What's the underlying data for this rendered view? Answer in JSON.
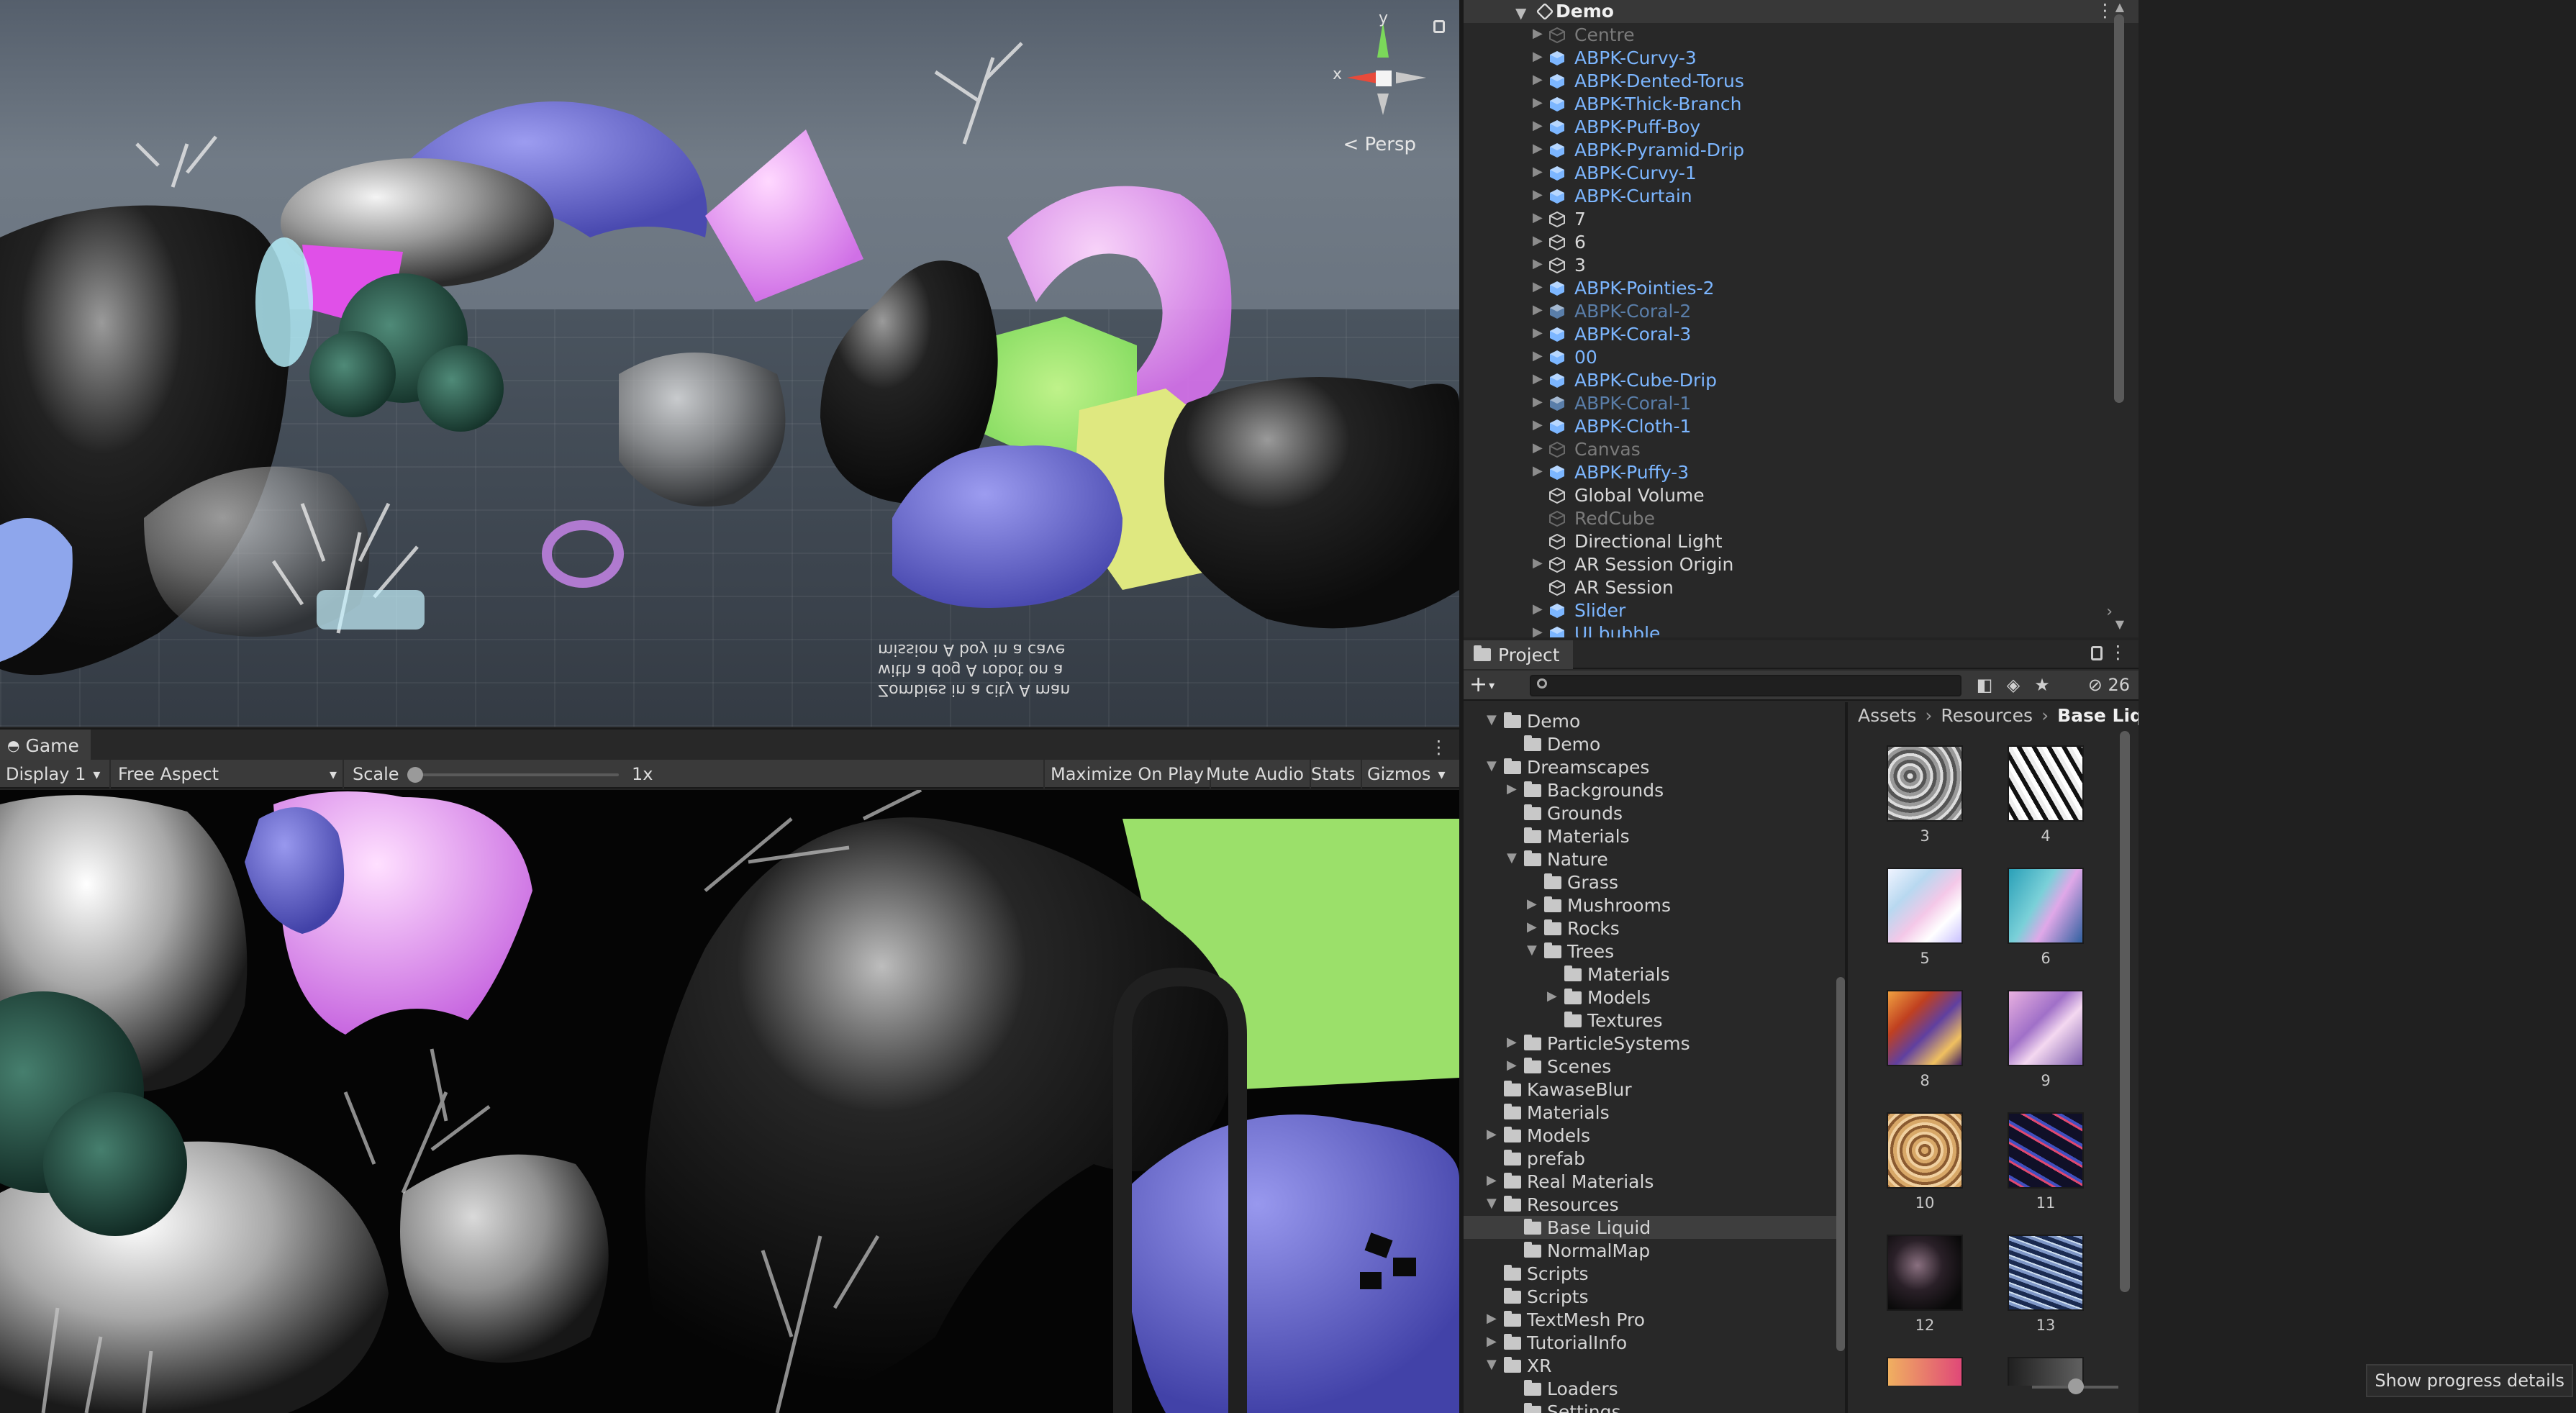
{
  "scene": {
    "persp_label": "Persp",
    "gizmo_axes": {
      "y": "y",
      "x": "x"
    },
    "overlay_text": "Zombies in a city A man with a dog A robot on a mission A boy in a cave"
  },
  "game": {
    "tab_label": "Game",
    "toolbar": {
      "display": "Display 1",
      "aspect": "Free Aspect",
      "scale_label": "Scale",
      "scale_value": "1x",
      "maximize": "Maximize On Play",
      "mute": "Mute Audio",
      "stats": "Stats",
      "gizmos": "Gizmos"
    }
  },
  "hierarchy": {
    "scene_name": "Demo",
    "items": [
      {
        "name": "Centre",
        "kind": "inactive",
        "expandable": true
      },
      {
        "name": "ABPK-Curvy-3",
        "kind": "prefab",
        "expandable": true
      },
      {
        "name": "ABPK-Dented-Torus",
        "kind": "prefab",
        "expandable": true
      },
      {
        "name": "ABPK-Thick-Branch",
        "kind": "prefab",
        "expandable": true
      },
      {
        "name": "ABPK-Puff-Boy",
        "kind": "prefab",
        "expandable": true
      },
      {
        "name": "ABPK-Pyramid-Drip",
        "kind": "prefab",
        "expandable": true
      },
      {
        "name": "ABPK-Curvy-1",
        "kind": "prefab",
        "expandable": true
      },
      {
        "name": "ABPK-Curtain",
        "kind": "prefab",
        "expandable": true
      },
      {
        "name": "7",
        "kind": "object",
        "expandable": true
      },
      {
        "name": "6",
        "kind": "object",
        "expandable": true
      },
      {
        "name": "3",
        "kind": "object",
        "expandable": true
      },
      {
        "name": "ABPK-Pointies-2",
        "kind": "prefab",
        "expandable": true
      },
      {
        "name": "ABPK-Coral-2",
        "kind": "prefab-inactive",
        "expandable": true
      },
      {
        "name": "ABPK-Coral-3",
        "kind": "prefab",
        "expandable": true
      },
      {
        "name": "00",
        "kind": "prefab",
        "expandable": true
      },
      {
        "name": "ABPK-Cube-Drip",
        "kind": "prefab",
        "expandable": true
      },
      {
        "name": "ABPK-Coral-1",
        "kind": "prefab-inactive",
        "expandable": true
      },
      {
        "name": "ABPK-Cloth-1",
        "kind": "prefab",
        "expandable": true
      },
      {
        "name": "Canvas",
        "kind": "inactive",
        "expandable": true
      },
      {
        "name": "ABPK-Puffy-3",
        "kind": "prefab",
        "expandable": true
      },
      {
        "name": "Global Volume",
        "kind": "object",
        "expandable": false
      },
      {
        "name": "RedCube",
        "kind": "inactive",
        "expandable": false
      },
      {
        "name": "Directional Light",
        "kind": "object",
        "expandable": false
      },
      {
        "name": "AR Session Origin",
        "kind": "object",
        "expandable": true
      },
      {
        "name": "AR Session",
        "kind": "object",
        "expandable": false
      },
      {
        "name": "Slider",
        "kind": "prefab",
        "expandable": true
      },
      {
        "name": "UI bubble",
        "kind": "prefab",
        "expandable": true
      }
    ]
  },
  "project": {
    "tab_label": "Project",
    "search": {
      "value": "",
      "placeholder": ""
    },
    "hidden_count": "26",
    "breadcrumb": [
      "Assets",
      "Resources",
      "Base Liquid"
    ],
    "tree": [
      {
        "label": "Demo",
        "depth": 0,
        "state": "open"
      },
      {
        "label": "Demo",
        "depth": 1,
        "state": "leaf"
      },
      {
        "label": "Dreamscapes",
        "depth": 0,
        "state": "open"
      },
      {
        "label": "Backgrounds",
        "depth": 1,
        "state": "closed"
      },
      {
        "label": "Grounds",
        "depth": 1,
        "state": "leaf"
      },
      {
        "label": "Materials",
        "depth": 1,
        "state": "leaf"
      },
      {
        "label": "Nature",
        "depth": 1,
        "state": "open"
      },
      {
        "label": "Grass",
        "depth": 2,
        "state": "leaf"
      },
      {
        "label": "Mushrooms",
        "depth": 2,
        "state": "closed"
      },
      {
        "label": "Rocks",
        "depth": 2,
        "state": "closed"
      },
      {
        "label": "Trees",
        "depth": 2,
        "state": "open"
      },
      {
        "label": "Materials",
        "depth": 3,
        "state": "leaf"
      },
      {
        "label": "Models",
        "depth": 3,
        "state": "closed"
      },
      {
        "label": "Textures",
        "depth": 3,
        "state": "leaf"
      },
      {
        "label": "ParticleSystems",
        "depth": 1,
        "state": "closed"
      },
      {
        "label": "Scenes",
        "depth": 1,
        "state": "closed"
      },
      {
        "label": "KawaseBlur",
        "depth": 0,
        "state": "leaf"
      },
      {
        "label": "Materials",
        "depth": 0,
        "state": "leaf"
      },
      {
        "label": "Models",
        "depth": 0,
        "state": "closed"
      },
      {
        "label": "prefab",
        "depth": 0,
        "state": "leaf"
      },
      {
        "label": "Real Materials",
        "depth": 0,
        "state": "closed"
      },
      {
        "label": "Resources",
        "depth": 0,
        "state": "open"
      },
      {
        "label": "Base Liquid",
        "depth": 1,
        "state": "leaf",
        "selected": true
      },
      {
        "label": "NormalMap",
        "depth": 1,
        "state": "leaf"
      },
      {
        "label": "Scripts",
        "depth": 0,
        "state": "leaf"
      },
      {
        "label": "Scripts",
        "depth": 0,
        "state": "leaf"
      },
      {
        "label": "TextMesh Pro",
        "depth": 0,
        "state": "closed"
      },
      {
        "label": "TutorialInfo",
        "depth": 0,
        "state": "closed"
      },
      {
        "label": "XR",
        "depth": 0,
        "state": "open"
      },
      {
        "label": "Loaders",
        "depth": 1,
        "state": "leaf"
      },
      {
        "label": "Settings",
        "depth": 1,
        "state": "leaf"
      }
    ],
    "assets": [
      {
        "label": "3",
        "style": "gray-marble"
      },
      {
        "label": "4",
        "style": "bw-swirl"
      },
      {
        "label": "5",
        "style": "pastel-wave"
      },
      {
        "label": "6",
        "style": "teal-pink"
      },
      {
        "label": "8",
        "style": "fire-purple"
      },
      {
        "label": "9",
        "style": "pink-lilac"
      },
      {
        "label": "10",
        "style": "gold-sand"
      },
      {
        "label": "11",
        "style": "dark-stripes"
      },
      {
        "label": "12",
        "style": "black-smoke"
      },
      {
        "label": "13",
        "style": "blue-water"
      },
      {
        "label": "",
        "style": "peach-partial"
      },
      {
        "label": "",
        "style": "dark-partial"
      }
    ]
  },
  "status": {
    "progress_button": "Show progress details"
  },
  "colors": {
    "prefab": "#7cb6ff",
    "panel": "#282828",
    "header": "#383838",
    "selection": "#3e3e3e"
  }
}
